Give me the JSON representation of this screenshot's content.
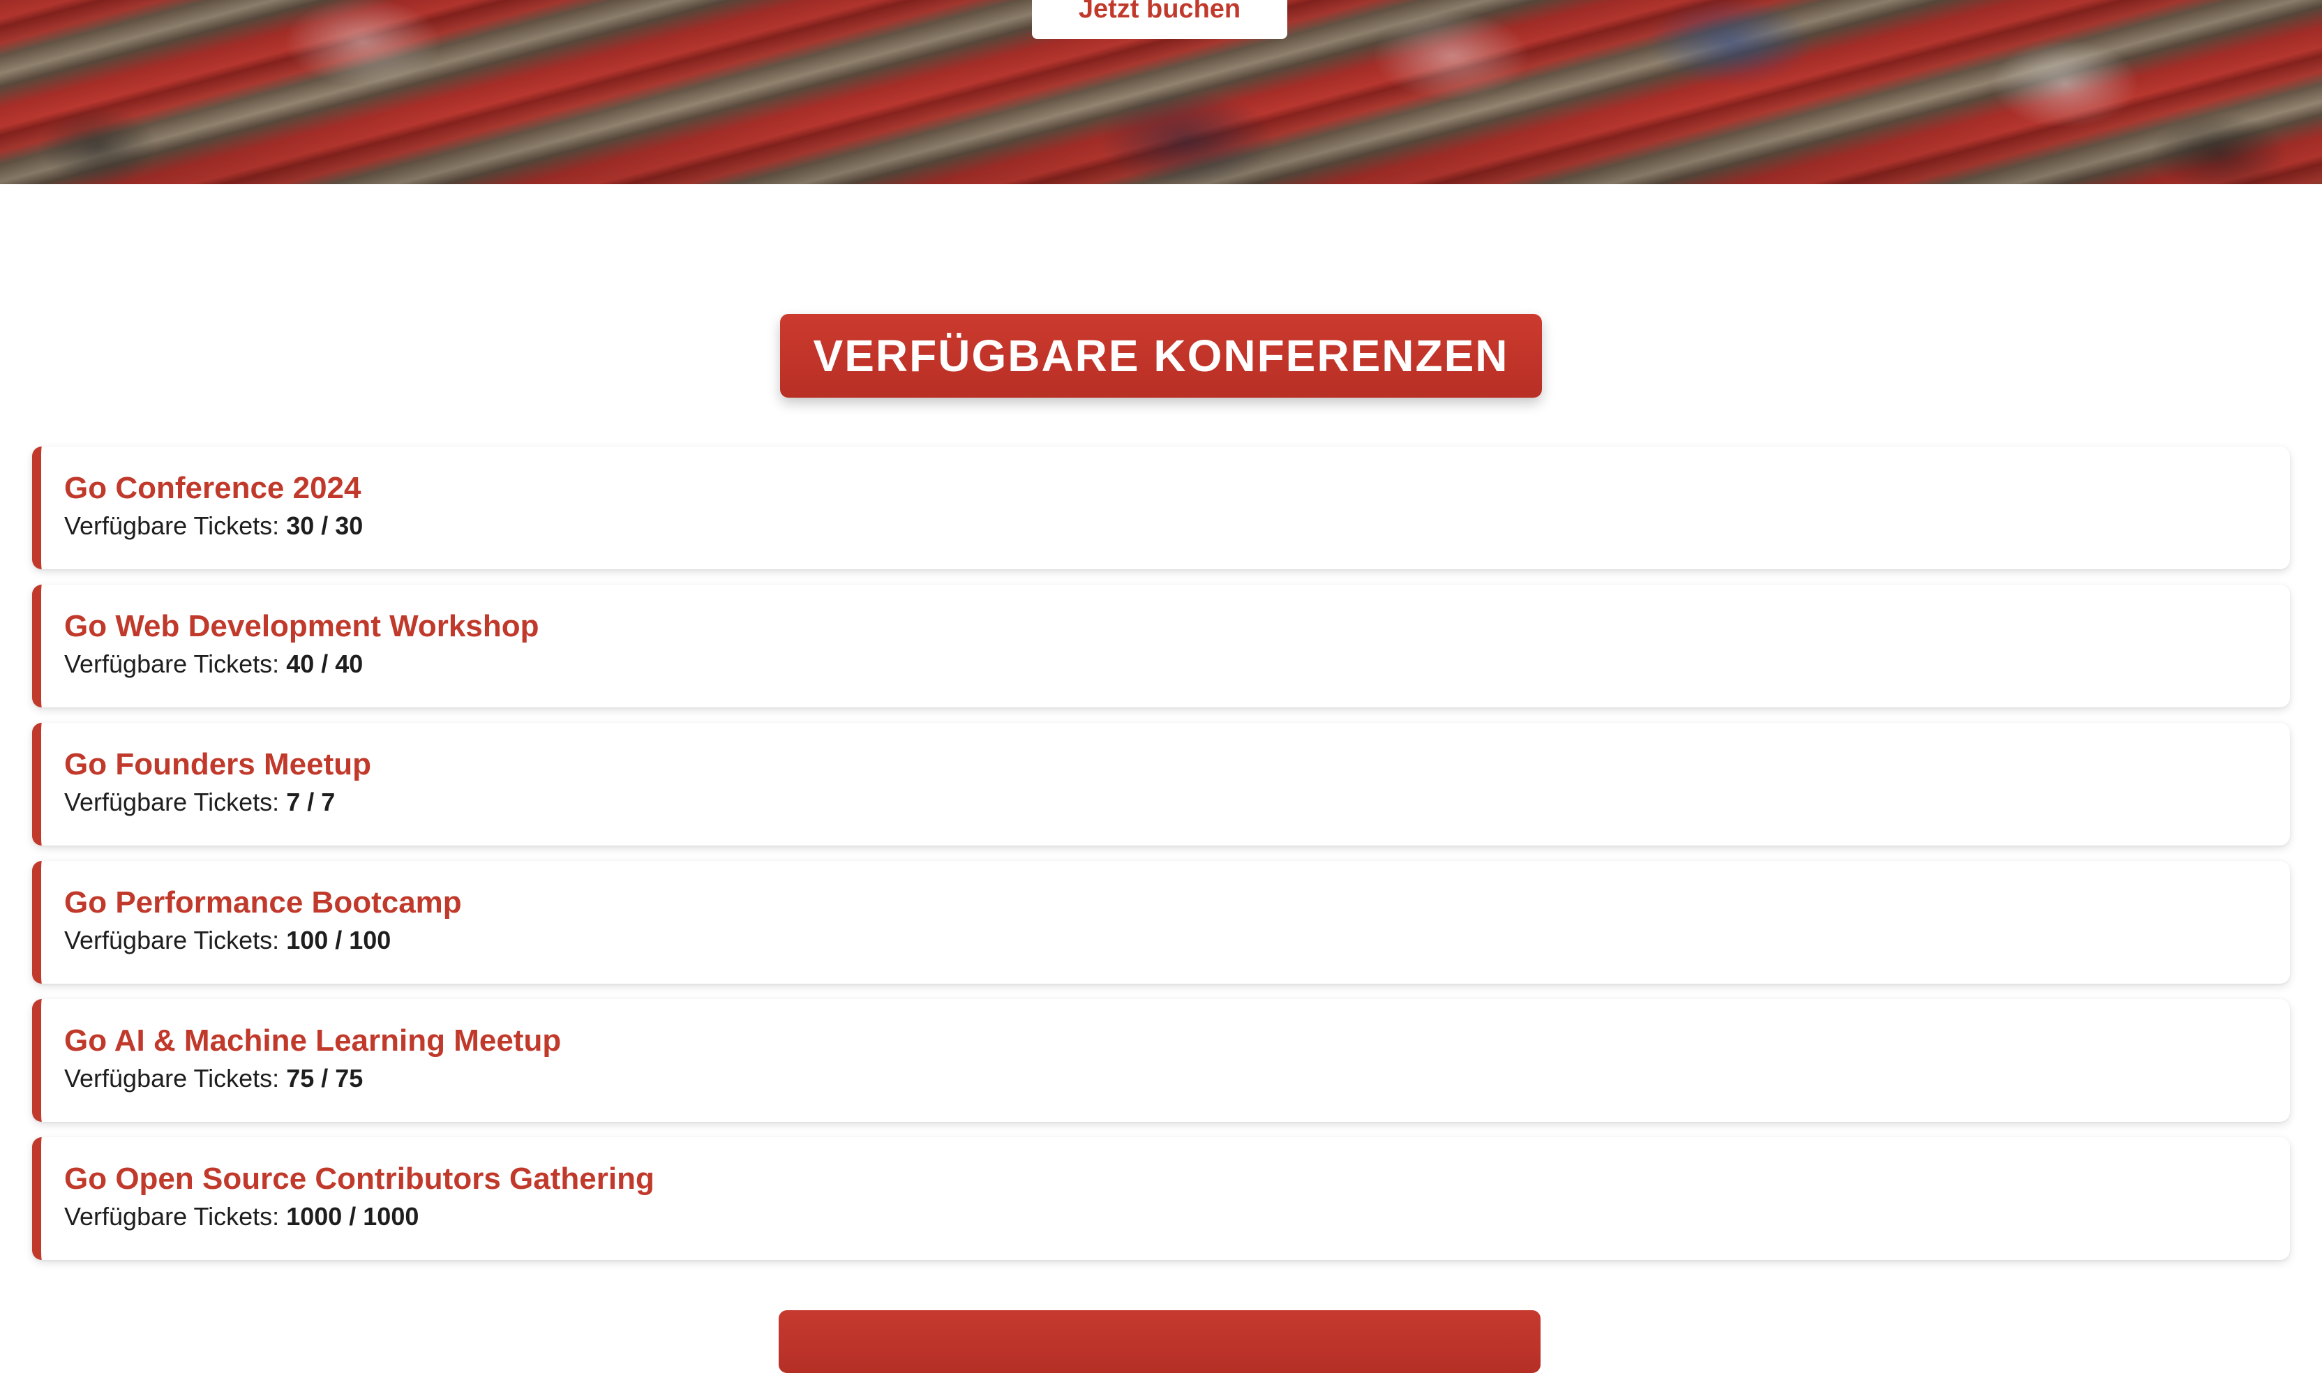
{
  "hero": {
    "book_button_label": "Jetzt buchen"
  },
  "section": {
    "title": "VERFÜGBARE KONFERENZEN"
  },
  "colors": {
    "accent": "#c0392b",
    "text": "#1e1e1e",
    "background": "#ffffff"
  },
  "conferences": [
    {
      "name": "Go Conference 2024",
      "tickets_label": "Verfügbare Tickets:",
      "tickets_value": "30 / 30"
    },
    {
      "name": "Go Web Development Workshop",
      "tickets_label": "Verfügbare Tickets:",
      "tickets_value": "40 / 40"
    },
    {
      "name": "Go Founders Meetup",
      "tickets_label": "Verfügbare Tickets:",
      "tickets_value": "7 / 7"
    },
    {
      "name": "Go Performance Bootcamp",
      "tickets_label": "Verfügbare Tickets:",
      "tickets_value": "100 / 100"
    },
    {
      "name": "Go AI & Machine Learning Meetup",
      "tickets_label": "Verfügbare Tickets:",
      "tickets_value": "75 / 75"
    },
    {
      "name": "Go Open Source Contributors Gathering",
      "tickets_label": "Verfügbare Tickets:",
      "tickets_value": "1000 / 1000"
    }
  ]
}
